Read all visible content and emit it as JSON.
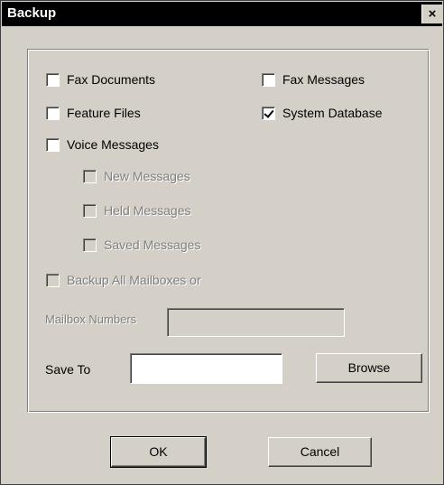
{
  "dialog": {
    "title": "Backup",
    "close_glyph": "×"
  },
  "options": {
    "fax_documents": {
      "label": "Fax Documents",
      "checked": false
    },
    "fax_messages": {
      "label": "Fax Messages",
      "checked": false
    },
    "feature_files": {
      "label": "Feature Files",
      "checked": false
    },
    "system_database": {
      "label": "System Database",
      "checked": true
    },
    "voice_messages": {
      "label": "Voice Messages",
      "checked": false
    },
    "new_messages": {
      "label": "New Messages",
      "checked": false,
      "enabled": false
    },
    "held_messages": {
      "label": "Held Messages",
      "checked": false,
      "enabled": false
    },
    "saved_messages": {
      "label": "Saved Messages",
      "checked": false,
      "enabled": false
    },
    "backup_all_mailboxes": {
      "label": "Backup All Mailboxes or",
      "checked": false,
      "enabled": false
    }
  },
  "mailbox_numbers": {
    "label": "Mailbox Numbers",
    "value": ""
  },
  "save_to": {
    "label": "Save To",
    "value": ""
  },
  "buttons": {
    "browse": "Browse",
    "ok": "OK",
    "cancel": "Cancel"
  },
  "icons": {
    "close": "close-icon",
    "check": "checkmark-icon"
  }
}
